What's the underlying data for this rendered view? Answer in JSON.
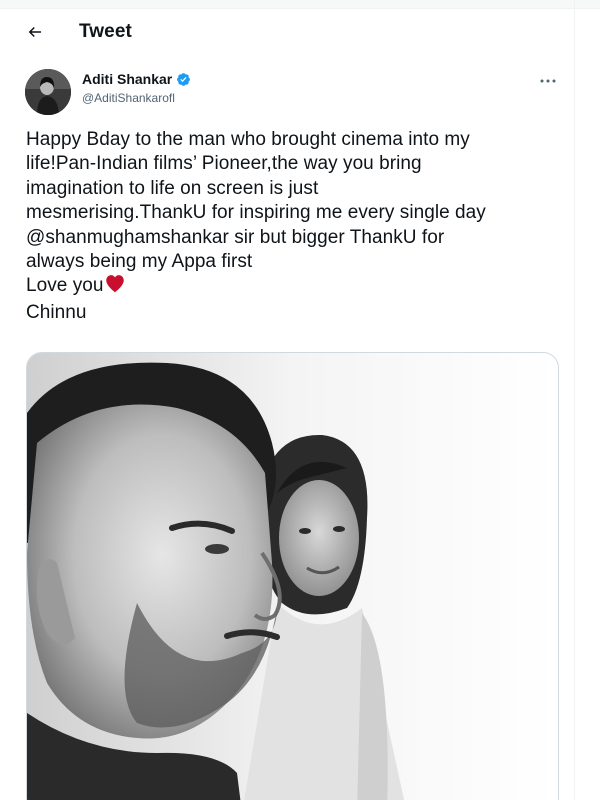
{
  "header": {
    "title": "Tweet"
  },
  "author": {
    "display_name": "Aditi Shankar",
    "handle": "@AditiShankarofl",
    "verified": true
  },
  "tweet": {
    "lines": [
      "Happy Bday to the man who brought cinema into my",
      "life!Pan-Indian films’ Pioneer,the way you bring",
      "imagination to life on screen is just",
      "mesmerising.ThankU for inspiring me every single day",
      "@shanmughamshankar sir but bigger ThankU for",
      "always being my Appa first",
      "Love you",
      "Chinnu"
    ],
    "heart_color": "#c8102e"
  },
  "colors": {
    "text": "#0f1419",
    "secondary": "#536471",
    "verified": "#1d9bf0",
    "border": "#cfd9de"
  },
  "icons": {
    "back": "arrow-left-icon",
    "verified": "verified-badge-icon",
    "more": "more-horizontal-icon",
    "heart": "heart-emoji-icon"
  }
}
